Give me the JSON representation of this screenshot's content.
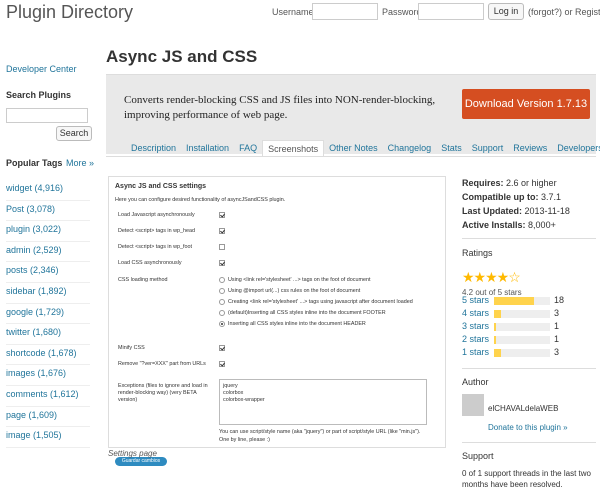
{
  "header": {
    "site_title": "Plugin Directory",
    "username_label": "Username",
    "password_label": "Password",
    "login_button": "Log in",
    "forgot_text": "(forgot?) or Register"
  },
  "sidebar": {
    "developer_center": "Developer Center",
    "search_heading": "Search Plugins",
    "search_button": "Search",
    "popular_heading": "Popular Tags",
    "more_link": "More »",
    "tags": [
      "widget (4,916)",
      "Post (3,078)",
      "plugin (3,022)",
      "admin (2,529)",
      "posts (2,346)",
      "sidebar (1,892)",
      "google (1,729)",
      "twitter (1,680)",
      "shortcode (1,678)",
      "images (1,676)",
      "comments (1,612)",
      "page (1,609)",
      "image (1,505)"
    ]
  },
  "plugin": {
    "title": "Async JS and CSS",
    "description": "Converts render-blocking CSS and JS files into NON-render-blocking, improving performance of web page.",
    "download_button": "Download Version 1.7.13",
    "tabs": [
      "Description",
      "Installation",
      "FAQ",
      "Screenshots",
      "Other Notes",
      "Changelog",
      "Stats",
      "Support",
      "Reviews",
      "Developers"
    ],
    "active_tab": "Screenshots"
  },
  "screenshot": {
    "title": "Async JS and CSS settings",
    "subtitle": "Here you can configure desired functionality of asyncJSandCSS plugin.",
    "options": [
      {
        "label": "Load Javascript asynchronously",
        "checked": true
      },
      {
        "label": "Detect <script> tags in wp_head",
        "checked": true
      },
      {
        "label": "Detect <script> tags in wp_foot",
        "checked": false
      },
      {
        "label": "Load CSS asynchronously",
        "checked": true
      }
    ],
    "css_method_label": "CSS loading method",
    "css_methods": [
      {
        "label": "Using <link rel='stylesheet' ...> tags on the foot of document",
        "checked": false
      },
      {
        "label": "Using @import url(...) css rules on the foot of document",
        "checked": false
      },
      {
        "label": "Creating <link rel='stylesheet' ...> tags using javascript after document loaded",
        "checked": false
      },
      {
        "label": "(default)Inserting all CSS styles inline into the document FOOTER",
        "checked": false
      },
      {
        "label": "Inserting all CSS styles inline into the document HEADER",
        "checked": true
      }
    ],
    "minify_label": "Minify CSS",
    "minify_checked": true,
    "remove_ver_label": "Remove \"?ver=XXX\" part from URLs",
    "remove_ver_checked": true,
    "exceptions_label": "Exceptions (files to ignore and load in render-blocking way) (very BETA version)",
    "exceptions_lines": [
      "jquery",
      "colorbox",
      "colorbox-wrapper"
    ],
    "hint1": "You can use script/style name (aka \"jquery\") or part of script/style URL (like \"min.js\").",
    "hint2": "One by line, please :)",
    "save_button": "Guardar cambios",
    "caption": "Settings page"
  },
  "meta": {
    "requires_label": "Requires:",
    "requires_value": "2.6 or higher",
    "compatible_label": "Compatible up to:",
    "compatible_value": "3.7.1",
    "updated_label": "Last Updated:",
    "updated_value": "2013-11-18",
    "installs_label": "Active Installs:",
    "installs_value": "8,000+",
    "ratings_heading": "Ratings",
    "stars_glyph": "★★★★☆",
    "average": "4.2 out of 5 stars",
    "breakdown": [
      {
        "label": "5 stars",
        "count": "18",
        "fraction": 0.72
      },
      {
        "label": "4 stars",
        "count": "3",
        "fraction": 0.12
      },
      {
        "label": "3 stars",
        "count": "1",
        "fraction": 0.04
      },
      {
        "label": "2 stars",
        "count": "1",
        "fraction": 0.04
      },
      {
        "label": "1 stars",
        "count": "3",
        "fraction": 0.12
      }
    ],
    "author_heading": "Author",
    "author_name": "elCHAVALdelaWEB",
    "donate": "Donate to this plugin »",
    "support_heading": "Support",
    "support_text": "0 of 1 support threads in the last two months have been resolved."
  }
}
